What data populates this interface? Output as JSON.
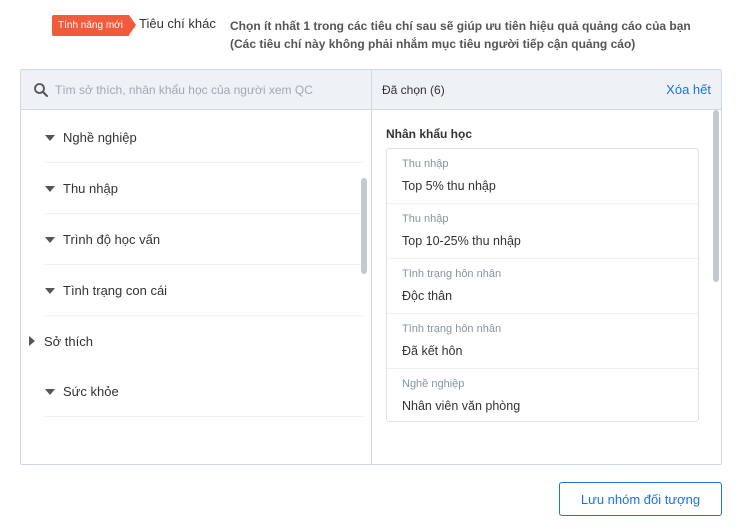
{
  "header": {
    "badge": "Tính năng mới",
    "criteria_label": "Tiêu chí khác",
    "description_line1": "Chọn ít nhất 1 trong các tiêu chí sau sẽ giúp ưu tiên hiệu quả quảng cáo của bạn",
    "description_line2": "(Các tiêu chí này không phải nhắm mục tiêu người tiếp cận quảng cáo)"
  },
  "search": {
    "placeholder": "Tìm sở thích, nhân khẩu học của người xem QC",
    "value": ""
  },
  "categories": [
    {
      "label": "Nghề nghiệp",
      "state": "expanded"
    },
    {
      "label": "Thu nhập",
      "state": "expanded"
    },
    {
      "label": "Trình độ học vấn",
      "state": "expanded"
    },
    {
      "label": "Tình trạng con cái",
      "state": "expanded"
    },
    {
      "label": "Sở thích",
      "state": "collapsed"
    },
    {
      "label": "Sức khỏe",
      "state": "expanded"
    }
  ],
  "selected": {
    "count_label": "Đã chọn (6)",
    "clear_all": "Xóa hết",
    "group_title": "Nhân khẩu học",
    "items": [
      {
        "category": "Thu nhập",
        "value": "Top 5% thu nhập"
      },
      {
        "category": "Thu nhập",
        "value": "Top 10-25% thu nhập"
      },
      {
        "category": "Tình trạng hôn nhân",
        "value": "Độc thân"
      },
      {
        "category": "Tình trạng hôn nhân",
        "value": "Đã kết hôn"
      },
      {
        "category": "Nghề nghiệp",
        "value": "Nhân viên văn phòng"
      }
    ]
  },
  "actions": {
    "save_label": "Lưu nhóm đối tượng"
  },
  "colors": {
    "accent": "#1a73e8",
    "badge": "#f25a3c",
    "panel_header_bg": "#eef2f6"
  }
}
